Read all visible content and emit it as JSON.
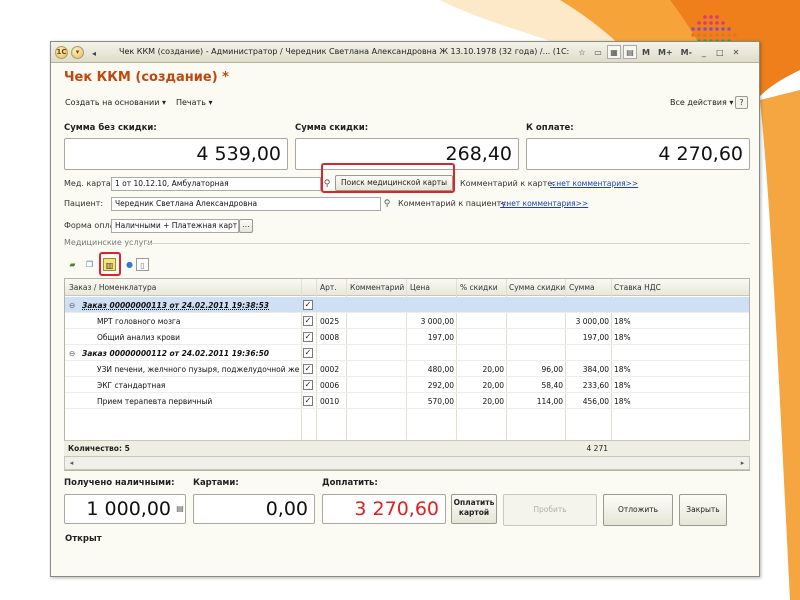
{
  "window": {
    "title": "Чек ККМ (создание) - Администратор / Чередник Светлана Александровна Ж 13.10.1978 (32 года) /...  (1С:Предприятие)",
    "tb_logo": "1С",
    "tb_m": "M",
    "tb_mplus": "M+",
    "tb_mminus": "M-"
  },
  "document": {
    "title": "Чек ККМ (создание) *",
    "create_based": "Создать на основании ▾",
    "print": "Печать ▾",
    "all_actions": "Все действия ▾",
    "help": "?"
  },
  "totals": {
    "no_discount_label": "Сумма без скидки:",
    "no_discount_value": "4 539,00",
    "discount_label": "Сумма скидки:",
    "discount_value": "268,40",
    "to_pay_label": "К оплате:",
    "to_pay_value": "4 270,60"
  },
  "fields": {
    "med_card_label": "Мед. карта:",
    "med_card_value": "1 от 10.12.10, Амбулаторная",
    "search_card_button": "Поиск медицинской карты",
    "comment_label": "Комментарий к карте:",
    "comment_link": "<нет комментария>>",
    "patient_label": "Пациент:",
    "patient_value": "Чередник Светлана Александровна",
    "patient_comment_label": "Комментарий к пациенту:",
    "patient_comment_link": "<нет комментария>>",
    "payment_label": "Форма оплаты:",
    "payment_value": "Наличными + Платежная карт.",
    "payment_more": "..."
  },
  "services": {
    "group_label": "Медицинские услуги",
    "columns": {
      "order": "Заказ / Номенклатура",
      "art": "Арт.",
      "comment": "Комментарий",
      "price": "Цена",
      "discount_pct": "% скидки",
      "discount_sum": "Сумма скидки",
      "sum": "Сумма",
      "vat": "Ставка НДС"
    },
    "rows": [
      {
        "name": "Заказ 00000000113 от 24.02.2011 19:38:53",
        "art": "",
        "price": "",
        "pct": "",
        "disc": "",
        "sum": "",
        "vat": ""
      },
      {
        "name": "МРТ головного мозга",
        "art": "0025",
        "price": "3 000,00",
        "pct": "",
        "disc": "",
        "sum": "3 000,00",
        "vat": "18%"
      },
      {
        "name": "Общий анализ крови",
        "art": "0008",
        "price": "197,00",
        "pct": "",
        "disc": "",
        "sum": "197,00",
        "vat": "18%"
      },
      {
        "name": "Заказ 00000000112 от 24.02.2011 19:36:50",
        "art": "",
        "price": "",
        "pct": "",
        "disc": "",
        "sum": "",
        "vat": ""
      },
      {
        "name": "УЗИ печени, желчного пузыря, поджелудочной жел...",
        "art": "0002",
        "price": "480,00",
        "pct": "20,00",
        "disc": "96,00",
        "sum": "384,00",
        "vat": "18%"
      },
      {
        "name": "ЭКГ стандартная",
        "art": "0006",
        "price": "292,00",
        "pct": "20,00",
        "disc": "58,40",
        "sum": "233,60",
        "vat": "18%"
      },
      {
        "name": "Прием терапевта первичный",
        "art": "0010",
        "price": "570,00",
        "pct": "20,00",
        "disc": "114,00",
        "sum": "456,00",
        "vat": "18%"
      }
    ],
    "footer_count": "Количество: 5",
    "footer_sum": "4 271"
  },
  "payment": {
    "cash_label": "Получено наличными:",
    "cash_value": "1 000,00",
    "cards_label": "Картами:",
    "cards_value": "0,00",
    "extra_label": "Доплатить:",
    "extra_value": "3 270,60",
    "pay_card_button": "Оплатить картой",
    "punch_button": "Пробить",
    "defer_button": "Отложить",
    "close_button": "Закрыть",
    "status": "Открыт"
  },
  "colors": {
    "title_orange": "#c0470e",
    "accent_orange": "#f39321",
    "highlight_red": "#d8262a",
    "extra_red": "#e2201d"
  }
}
